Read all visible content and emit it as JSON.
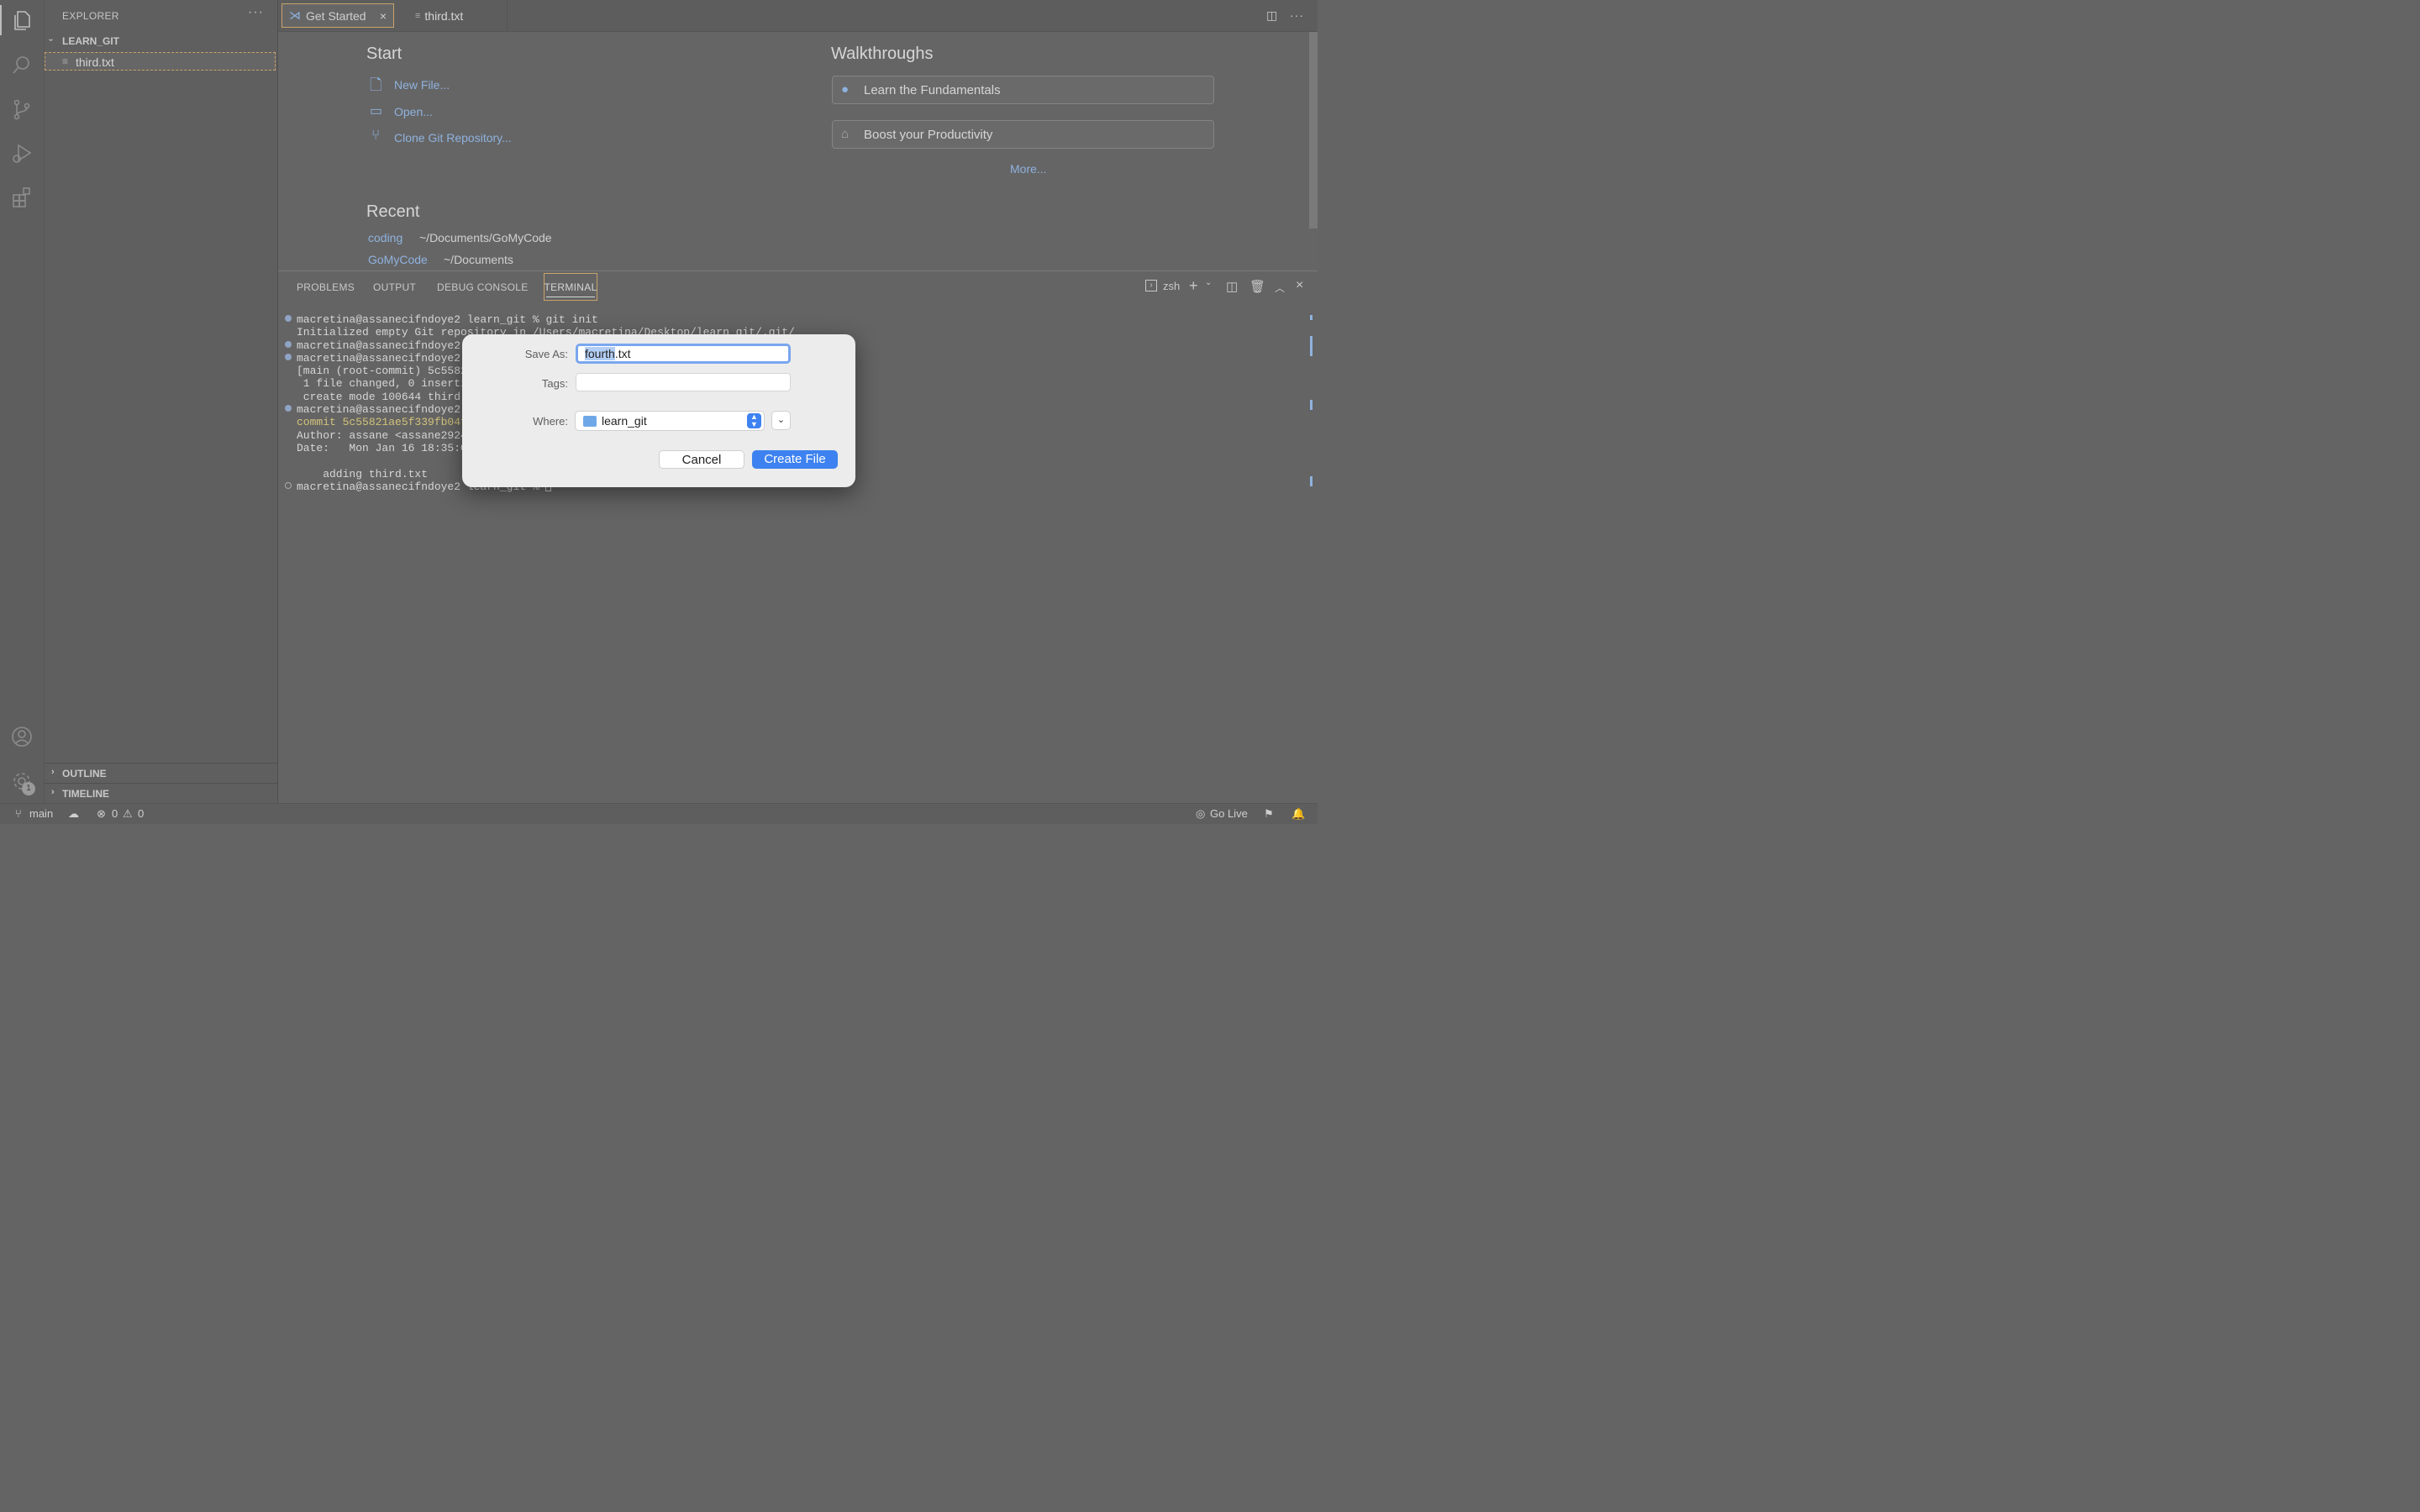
{
  "sidebar": {
    "title": "EXPLORER",
    "more": "···",
    "folder": "LEARN_GIT",
    "file": "third.txt",
    "sections": [
      "OUTLINE",
      "TIMELINE"
    ]
  },
  "activity": {
    "badge": "1"
  },
  "tabs": [
    {
      "label": "Get Started",
      "active": true
    },
    {
      "label": "third.txt",
      "active": false
    }
  ],
  "welcome": {
    "start_heading": "Start",
    "start_items": [
      "New File...",
      "Open...",
      "Clone Git Repository..."
    ],
    "walk_heading": "Walkthroughs",
    "walk_items": [
      "Learn the Fundamentals",
      "Boost your Productivity"
    ],
    "more": "More...",
    "recent_heading": "Recent",
    "recent": [
      {
        "name": "coding",
        "path": "~/Documents/GoMyCode"
      },
      {
        "name": "GoMyCode",
        "path": "~/Documents"
      }
    ]
  },
  "panel": {
    "tabs": [
      "PROBLEMS",
      "OUTPUT",
      "DEBUG CONSOLE",
      "TERMINAL"
    ],
    "shell": "zsh",
    "terminal": [
      {
        "dot": "filled",
        "text": "macretina@assanecifndoye2 learn_git % git init"
      },
      {
        "dot": "none",
        "text": "Initialized empty Git repository in /Users/macretina/Desktop/learn_git/.git/"
      },
      {
        "dot": "filled",
        "text": "macretina@assanecifndoye2"
      },
      {
        "dot": "filled",
        "text": "macretina@assanecifndoye2"
      },
      {
        "dot": "none",
        "text": "[main (root-commit) 5c5582"
      },
      {
        "dot": "none",
        "text": " 1 file changed, 0 inserti"
      },
      {
        "dot": "none",
        "text": " create mode 100644 third."
      },
      {
        "dot": "filled",
        "text": "macretina@assanecifndoye2"
      },
      {
        "dot": "none",
        "text": "commit 5c55821ae5f339fb04f",
        "yellow": true
      },
      {
        "dot": "none",
        "text": "Author: assane <assane2924"
      },
      {
        "dot": "none",
        "text": "Date:   Mon Jan 16 18:35:0"
      },
      {
        "dot": "none",
        "text": ""
      },
      {
        "dot": "none",
        "text": "    adding third.txt"
      },
      {
        "dot": "open",
        "text": "macretina@assanecifndoye2 learn_git % "
      }
    ]
  },
  "dialog": {
    "save_as_label": "Save As:",
    "save_as_selected": "fourth",
    "save_as_rest": ".txt",
    "tags_label": "Tags:",
    "where_label": "Where:",
    "where_value": "learn_git",
    "cancel": "Cancel",
    "create": "Create File"
  },
  "status": {
    "branch": "main",
    "errors": "0",
    "warnings": "0",
    "go_live": "Go Live"
  }
}
